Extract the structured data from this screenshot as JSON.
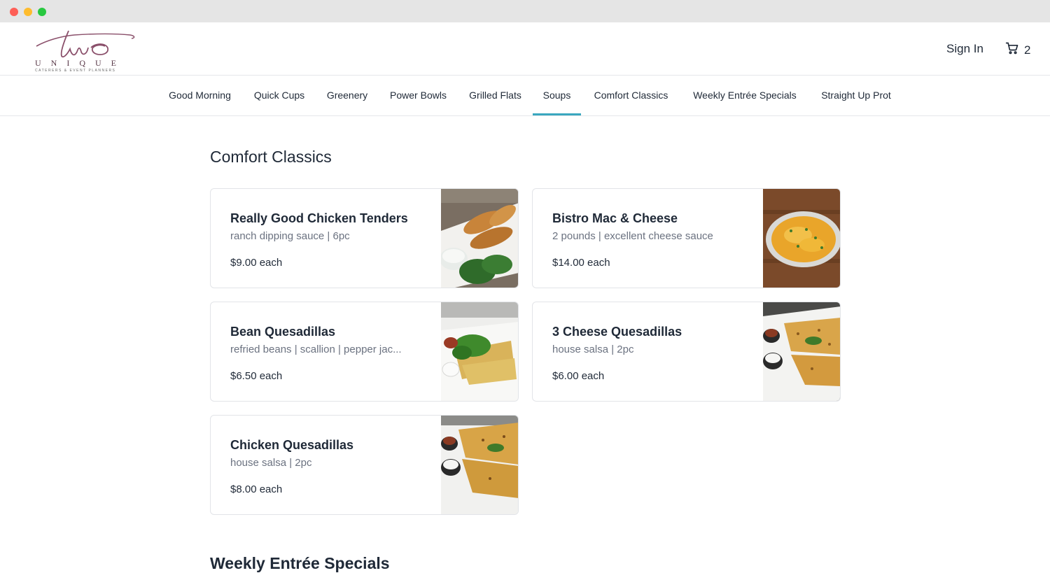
{
  "window": {
    "title_bar_buttons": [
      "close",
      "minimize",
      "zoom"
    ]
  },
  "header": {
    "logo_word": "two",
    "logo_sub": "UNIQUE",
    "logo_tagline": "CATERERS & EVENT PLANNERS",
    "signin_label": "Sign In",
    "cart_icon": "cart-icon",
    "cart_count": "2"
  },
  "nav": {
    "items": [
      {
        "label": "Good Morning"
      },
      {
        "label": "Quick Cups"
      },
      {
        "label": "Greenery"
      },
      {
        "label": "Power Bowls"
      },
      {
        "label": "Grilled Flats"
      },
      {
        "label": "Soups"
      },
      {
        "label": "Comfort Classics"
      },
      {
        "label": "Weekly Entrée Specials"
      },
      {
        "label": "Straight Up Prot"
      }
    ],
    "active": "Soups",
    "accent_color": "#3aa7bf"
  },
  "section": {
    "title": "Comfort Classics",
    "items": [
      {
        "name": "Really Good Chicken Tenders",
        "desc": "ranch dipping sauce | 6pc",
        "price": "$9.00 each",
        "image": "chicken-tenders-photo"
      },
      {
        "name": "Bistro Mac & Cheese",
        "desc": "2 pounds | excellent cheese sauce",
        "price": "$14.00 each",
        "image": "mac-and-cheese-photo"
      },
      {
        "name": "Bean Quesadillas",
        "desc": "refried beans | scallion | pepper jac...",
        "price": "$6.50 each",
        "image": "bean-quesadillas-photo"
      },
      {
        "name": "3 Cheese Quesadillas",
        "desc": "house salsa | 2pc",
        "price": "$6.00 each",
        "image": "cheese-quesadillas-photo"
      },
      {
        "name": "Chicken Quesadillas",
        "desc": "house salsa | 2pc",
        "price": "$8.00 each",
        "image": "chicken-quesadillas-photo"
      }
    ]
  },
  "next_section": {
    "title": "Weekly Entrée Specials"
  }
}
